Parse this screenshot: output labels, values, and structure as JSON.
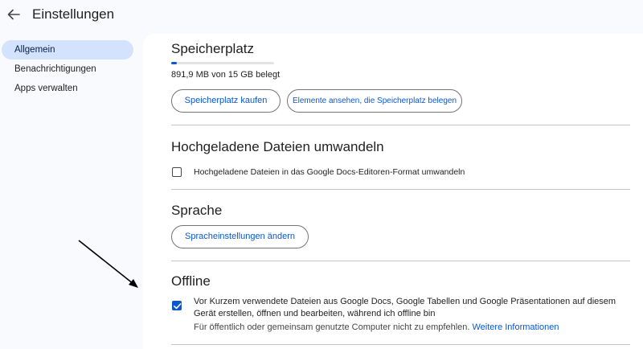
{
  "header": {
    "title": "Einstellungen",
    "back_icon": "arrow-back-icon"
  },
  "sidebar": {
    "items": [
      {
        "label": "Allgemein",
        "active": true
      },
      {
        "label": "Benachrichtigungen",
        "active": false
      },
      {
        "label": "Apps verwalten",
        "active": false
      }
    ]
  },
  "storage": {
    "title": "Speicherplatz",
    "usage": "891,9 MB von 15 GB belegt",
    "used_fraction": 0.058,
    "buy_button": "Speicherplatz kaufen",
    "view_button": "Elemente ansehen, die Speicherplatz belegen"
  },
  "convert": {
    "title": "Hochgeladene Dateien umwandeln",
    "checkbox_label": "Hochgeladene Dateien in das Google Docs-Editoren-Format umwandeln",
    "checked": false
  },
  "language": {
    "title": "Sprache",
    "button": "Spracheinstellungen ändern"
  },
  "offline": {
    "title": "Offline",
    "checkbox_label": "Vor Kurzem verwendete Dateien aus Google Docs, Google Tabellen und Google Präsentationen auf diesem Gerät erstellen, öffnen und bearbeiten, während ich offline bin",
    "checked": true,
    "note": "Für öffentlich oder gemeinsam genutzte Computer nicht zu empfehlen.",
    "link": "Weitere Informationen"
  },
  "colors": {
    "accent": "#0b57d0",
    "nav_active": "#d3e3fd",
    "background": "#f8fafd"
  }
}
